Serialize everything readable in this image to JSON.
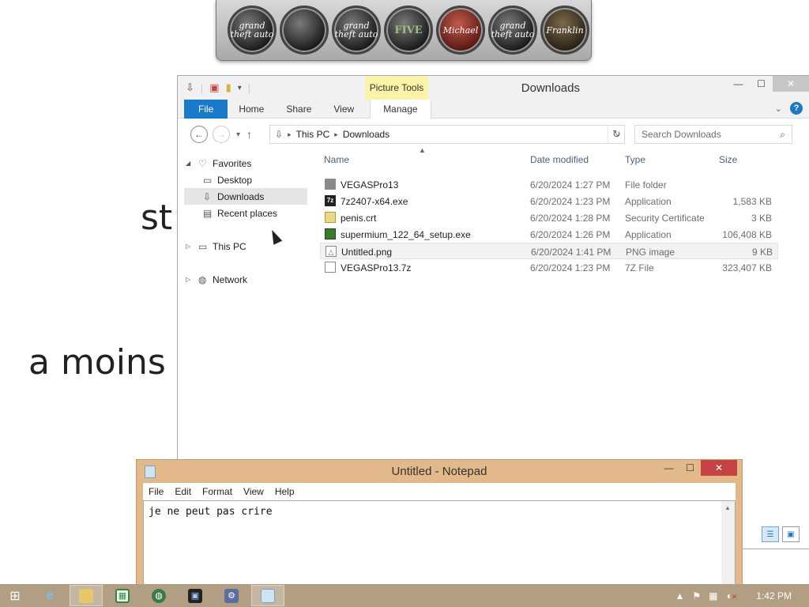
{
  "background": {
    "text_st": "st",
    "text_moins": "a moins"
  },
  "game_dock": {
    "icons": [
      {
        "name": "gta-vice-city-icon",
        "label": "grand theft auto"
      },
      {
        "name": "gta-v-character-icon",
        "label": ""
      },
      {
        "name": "gta-characters-icon",
        "label": "grand theft auto"
      },
      {
        "name": "gta-five-logo-icon",
        "label": "FIVE"
      },
      {
        "name": "michael-icon",
        "label": "Michael"
      },
      {
        "name": "gta-trevor-icon",
        "label": "grand theft auto"
      },
      {
        "name": "franklin-icon",
        "label": "Franklin"
      }
    ]
  },
  "explorer": {
    "title": "Downloads",
    "contextual_tab_group": "Picture Tools",
    "tabs": [
      "File",
      "Home",
      "Share",
      "View",
      "Manage"
    ],
    "breadcrumb": [
      "This PC",
      "Downloads"
    ],
    "search_placeholder": "Search Downloads",
    "nav": {
      "favorites": "Favorites",
      "desktop": "Desktop",
      "downloads": "Downloads",
      "recent_places": "Recent places",
      "this_pc": "This PC",
      "network": "Network"
    },
    "columns": {
      "name": "Name",
      "date": "Date modified",
      "type": "Type",
      "size": "Size"
    },
    "files": [
      {
        "name": "VEGASPro13",
        "date": "6/20/2024 1:27 PM",
        "type": "File folder",
        "size": "",
        "icon": "folder-icon"
      },
      {
        "name": "7z2407-x64.exe",
        "date": "6/20/2024 1:23 PM",
        "type": "Application",
        "size": "1,583 KB",
        "icon": "7z-app-icon"
      },
      {
        "name": "penis.crt",
        "date": "6/20/2024 1:28 PM",
        "type": "Security Certificate",
        "size": "3 KB",
        "icon": "certificate-icon"
      },
      {
        "name": "supermium_122_64_setup.exe",
        "date": "6/20/2024 1:26 PM",
        "type": "Application",
        "size": "106,408 KB",
        "icon": "setup-app-icon"
      },
      {
        "name": "Untitled.png",
        "date": "6/20/2024 1:41 PM",
        "type": "PNG image",
        "size": "9 KB",
        "icon": "png-image-icon"
      },
      {
        "name": "VEGASPro13.7z",
        "date": "6/20/2024 1:23 PM",
        "type": "7Z File",
        "size": "323,407 KB",
        "icon": "archive-file-icon"
      }
    ]
  },
  "notepad": {
    "title": "Untitled - Notepad",
    "menu": [
      "File",
      "Edit",
      "Format",
      "View",
      "Help"
    ],
    "content": "je ne peut pas crire"
  },
  "taskbar": {
    "clock": "1:42 PM"
  }
}
